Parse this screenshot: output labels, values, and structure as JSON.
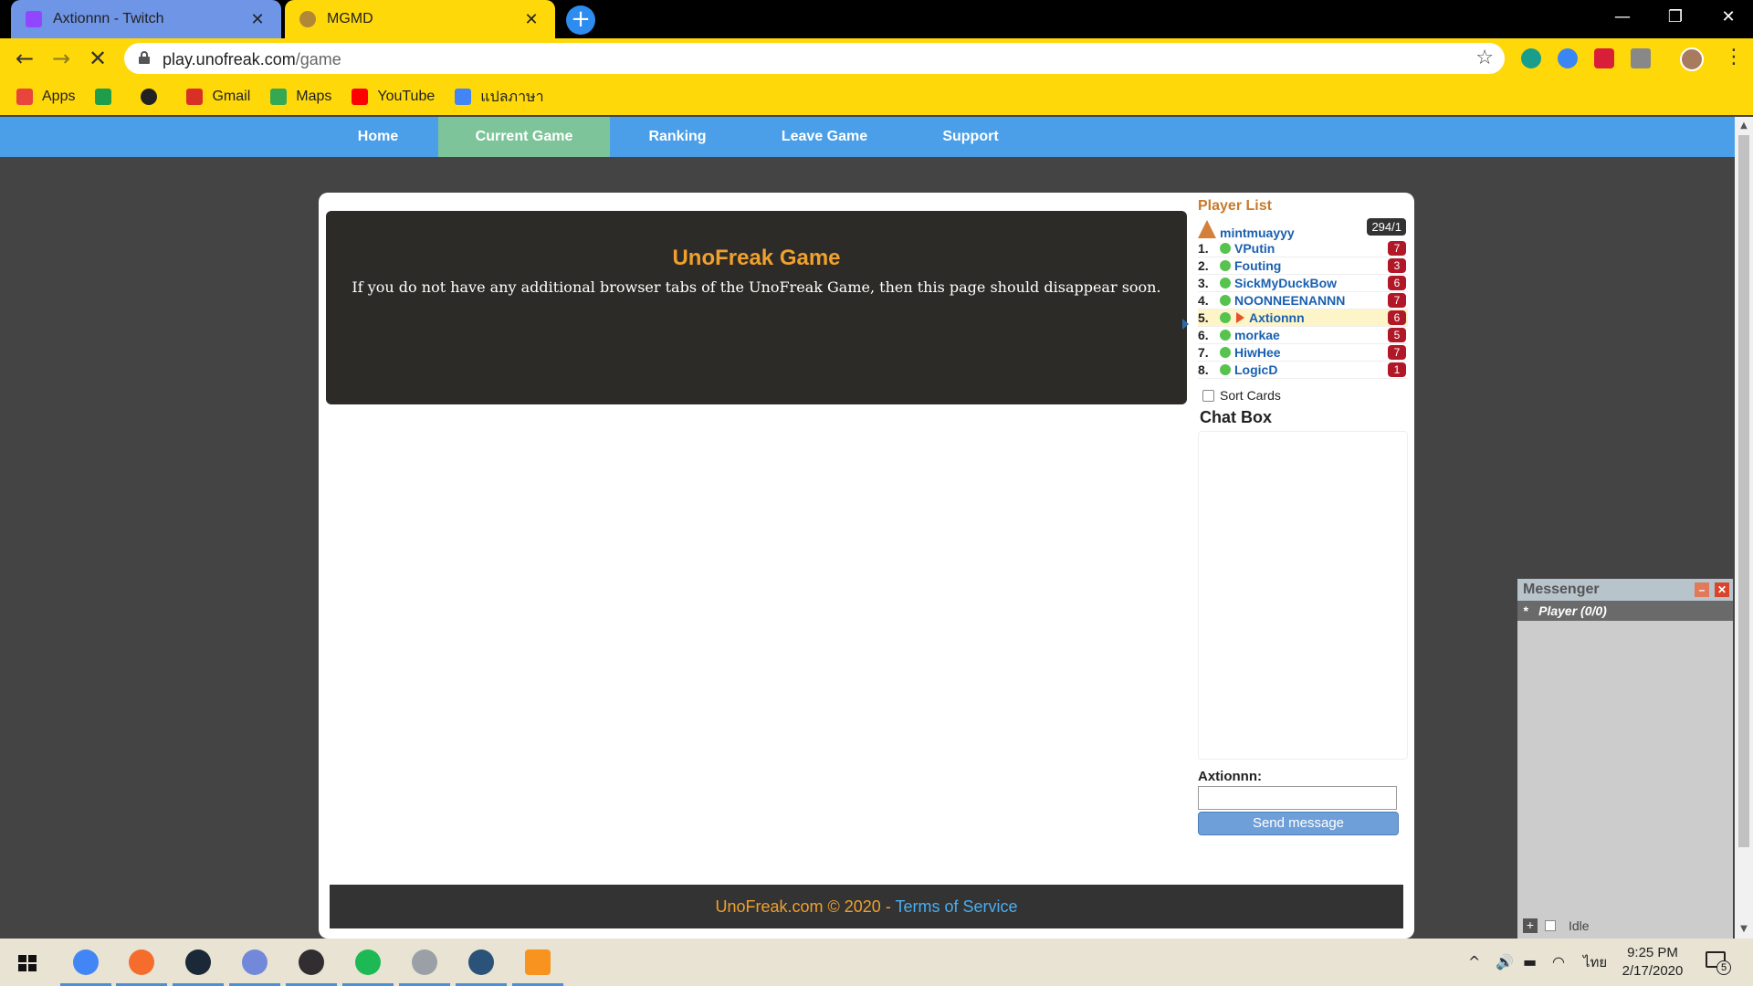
{
  "browser": {
    "tabs": [
      {
        "label": "Axtionnn - Twitch",
        "icon": "twitch-icon",
        "active": false
      },
      {
        "label": "MGMD",
        "icon": "mgmd-icon",
        "active": true
      }
    ],
    "url_domain": "play.unofreak.com",
    "url_path": "/game",
    "bookmarks": [
      {
        "label": "Apps",
        "icon": "apps-grid-icon",
        "color": "#e8453c"
      },
      {
        "label": "",
        "icon": "green-plus-icon",
        "color": "#1e9e4a"
      },
      {
        "label": "",
        "icon": "globe-icon",
        "color": "#222222"
      },
      {
        "label": "Gmail",
        "icon": "gmail-icon",
        "color": "#d93025"
      },
      {
        "label": "Maps",
        "icon": "maps-icon",
        "color": "#34a853"
      },
      {
        "label": "YouTube",
        "icon": "youtube-icon",
        "color": "#ff0000"
      },
      {
        "label": "แปลภาษา",
        "icon": "translate-icon",
        "color": "#4285f4"
      }
    ]
  },
  "nav": {
    "items": [
      "Home",
      "Current Game",
      "Ranking",
      "Leave Game",
      "Support"
    ],
    "active": "Current Game"
  },
  "game": {
    "title": "UnoFreak Game",
    "message": "If you do not have any additional browser tabs of the UnoFreak Game, then this page should disappear soon."
  },
  "player_list": {
    "title": "Player List",
    "host": "mintmuayyy",
    "score": "294/1",
    "players": [
      {
        "num": "1.",
        "name": "VPutin",
        "cards": "7",
        "current": false
      },
      {
        "num": "2.",
        "name": "Fouting",
        "cards": "3",
        "current": false
      },
      {
        "num": "3.",
        "name": "SickMyDuckBow",
        "cards": "6",
        "current": false
      },
      {
        "num": "4.",
        "name": "NOONNEENANNN",
        "cards": "7",
        "current": false
      },
      {
        "num": "5.",
        "name": "Axtionnn",
        "cards": "6",
        "current": true
      },
      {
        "num": "6.",
        "name": "morkae",
        "cards": "5",
        "current": false
      },
      {
        "num": "7.",
        "name": "HiwHee",
        "cards": "7",
        "current": false
      },
      {
        "num": "8.",
        "name": "LogicD",
        "cards": "1",
        "current": false
      }
    ],
    "sort_label": "Sort Cards"
  },
  "chat": {
    "title": "Chat Box",
    "username_label": "Axtionnn:",
    "input_value": "",
    "send_label": "Send message"
  },
  "footer": {
    "copyright": "UnoFreak.com © 2020 - ",
    "tos": "Terms of Service"
  },
  "messenger": {
    "title": "Messenger",
    "player_label": "Player (0/0)",
    "bullet": "*",
    "status": "Idle"
  },
  "taskbar": {
    "time": "9:25 PM",
    "date": "2/17/2020",
    "language": "ไทย",
    "notifications": "5",
    "apps": [
      {
        "name": "chrome",
        "color": "#4285f4",
        "open": true
      },
      {
        "name": "origin",
        "color": "#f56c2d",
        "open": true
      },
      {
        "name": "steam",
        "color": "#1b2838",
        "open": true
      },
      {
        "name": "discord",
        "color": "#7289da",
        "open": true
      },
      {
        "name": "obs",
        "color": "#302e31",
        "open": true
      },
      {
        "name": "spotify",
        "color": "#1db954",
        "open": true
      },
      {
        "name": "cd-player",
        "color": "#9aa0a6",
        "open": true
      },
      {
        "name": "headset-app",
        "color": "#2b5278",
        "open": true
      },
      {
        "name": "unofreak",
        "color": "#f7931e",
        "open": true
      }
    ]
  }
}
